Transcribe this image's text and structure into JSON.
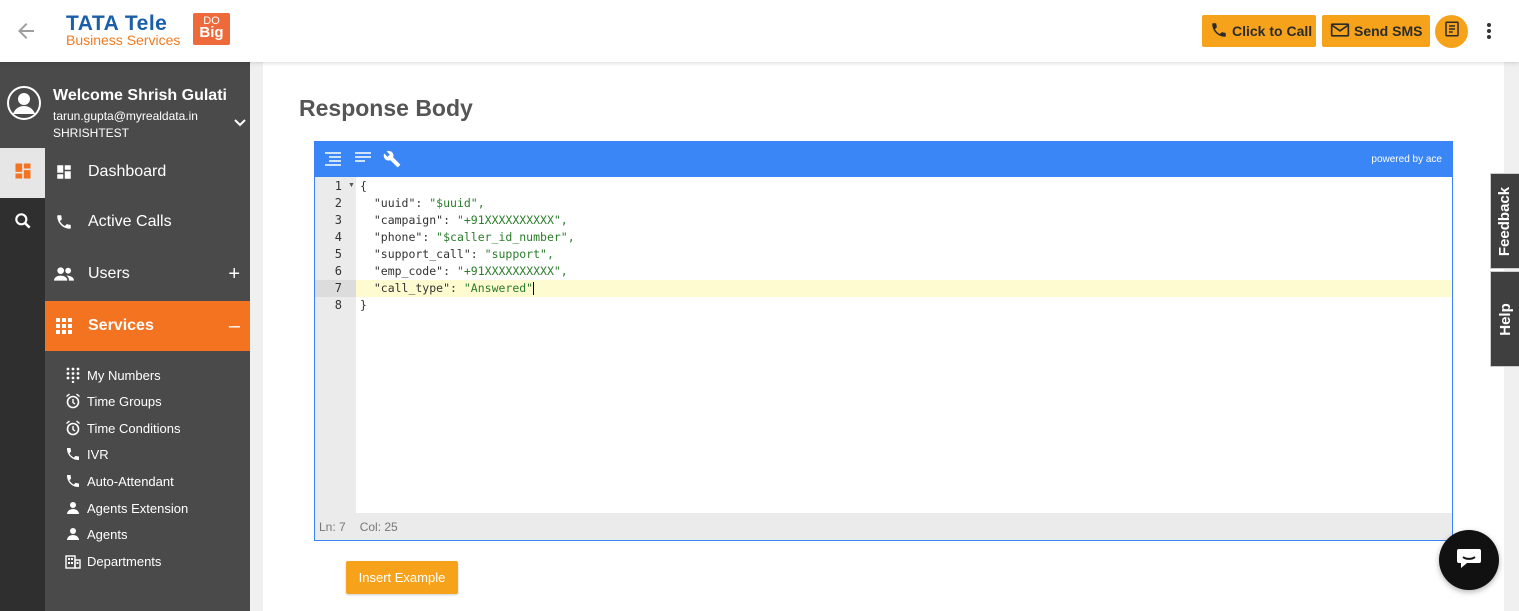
{
  "header": {
    "logo_brand": "TATA Tele",
    "logo_subtitle": "Business Services",
    "logo_badge_top": "DO",
    "logo_badge_bottom": "Big",
    "click_to_call": "Click to Call",
    "send_sms": "Send SMS"
  },
  "user": {
    "welcome": "Welcome Shrish Gulati",
    "email": "tarun.gupta@myrealdata.in",
    "org": "SHRISHTEST"
  },
  "nav": {
    "dashboard": "Dashboard",
    "active_calls": "Active Calls",
    "users": "Users",
    "users_sign": "+",
    "services": "Services",
    "services_sign": "–"
  },
  "services_sub": [
    {
      "label": "My Numbers",
      "icon": "dialpad-icon"
    },
    {
      "label": "Time Groups",
      "icon": "alarm-icon"
    },
    {
      "label": "Time Conditions",
      "icon": "alarm-icon"
    },
    {
      "label": "IVR",
      "icon": "phone-forward-icon"
    },
    {
      "label": "Auto-Attendant",
      "icon": "phone-forward-icon"
    },
    {
      "label": "Agents Extension",
      "icon": "person-icon"
    },
    {
      "label": "Agents",
      "icon": "person-icon"
    },
    {
      "label": "Departments",
      "icon": "building-icon"
    }
  ],
  "main": {
    "title": "Response Body",
    "editor": {
      "powered_by": "powered by ace",
      "line_numbers": [
        "1",
        "2",
        "3",
        "4",
        "5",
        "6",
        "7",
        "8"
      ],
      "lines": [
        {
          "key": "{",
          "sep": "",
          "val": ""
        },
        {
          "key": "  \"uuid\"",
          "sep": ": ",
          "val": "\"$uuid\","
        },
        {
          "key": "  \"campaign\"",
          "sep": ": ",
          "val": "\"+91XXXXXXXXXX\","
        },
        {
          "key": "  \"phone\"",
          "sep": ": ",
          "val": "\"$caller_id_number\","
        },
        {
          "key": "  \"support_call\"",
          "sep": ": ",
          "val": "\"support\","
        },
        {
          "key": "  \"emp_code\"",
          "sep": ": ",
          "val": "\"+91XXXXXXXXXX\","
        },
        {
          "key": "  \"call_type\"",
          "sep": ": ",
          "val": "\"Answered\""
        },
        {
          "key": "}",
          "sep": "",
          "val": ""
        }
      ],
      "active_line": 7,
      "status_ln": "Ln: 7",
      "status_col": "Col: 25"
    },
    "insert_example": "Insert Example"
  },
  "side_tabs": {
    "feedback": "Feedback",
    "help": "Help"
  },
  "colors": {
    "accent_orange": "#f6a31b",
    "active_nav": "#f37321",
    "editor_toolbar": "#3b86f7",
    "sidebar": "#4a4a4a"
  }
}
